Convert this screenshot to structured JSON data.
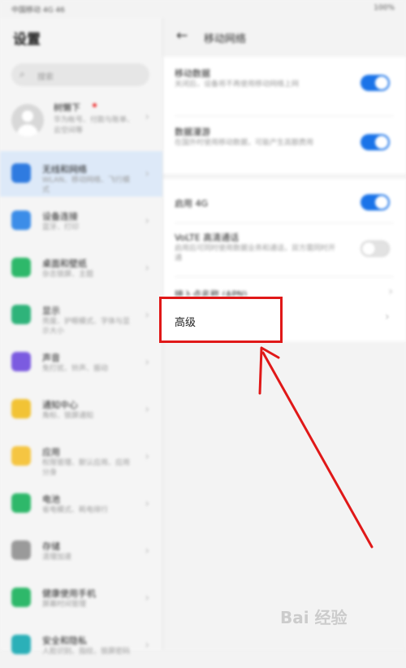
{
  "status_bar": {
    "left": "中国移动 4G 46",
    "right": "100%"
  },
  "settings": {
    "title": "设置",
    "search_placeholder": "搜索",
    "profile": {
      "name": "树懒下",
      "desc": "华为帐号、付款与账单、云空间等"
    },
    "items": [
      {
        "title": "无线和网络",
        "desc": "WLAN、移动网络、飞行模式",
        "color": "#2f7be0",
        "selected": true
      },
      {
        "title": "设备连接",
        "desc": "蓝牙、打印",
        "color": "#3c8de8"
      },
      {
        "title": "桌面和壁纸",
        "desc": "杂志锁屏、主题",
        "color": "#2eb86a"
      },
      {
        "title": "显示",
        "desc": "亮度、护眼模式、字体与显示大小",
        "color": "#2fb37a"
      },
      {
        "title": "声音",
        "desc": "免打扰、铃声、振动",
        "color": "#7b5be0"
      },
      {
        "title": "通知中心",
        "desc": "角标、锁屏通知",
        "color": "#f2c335"
      },
      {
        "title": "应用",
        "desc": "权限管理、默认应用、应用分身",
        "color": "#f5c542"
      },
      {
        "title": "电池",
        "desc": "省电模式、耗电排行",
        "color": "#2eb86a"
      },
      {
        "title": "存储",
        "desc": "清理加速",
        "color": "#9a9a9a"
      },
      {
        "title": "健康使用手机",
        "desc": "屏幕时间管理",
        "color": "#2eb86a"
      },
      {
        "title": "安全和隐私",
        "desc": "人脸识别、指纹、锁屏密码",
        "color": "#2bb0b8"
      }
    ]
  },
  "mobile_network": {
    "title": "移动网络",
    "rows": [
      {
        "title": "移动数据",
        "desc": "关闭后，设备将不再使用移动网络上网",
        "toggle": "on"
      },
      {
        "title": "数据漫游",
        "desc": "在国外时使用移动数据，可能产生高额费用",
        "toggle": "on"
      },
      {
        "title": "启用 4G",
        "desc": "",
        "toggle": "on"
      },
      {
        "title": "VoLTE 高清通话",
        "desc": "启用后可同时使用数据业务和通话，双方需同时开通",
        "toggle": "off"
      },
      {
        "title": "接入点名称 (APN)",
        "desc": "",
        "toggle": "none"
      }
    ],
    "advanced_label": "高级"
  },
  "watermark": "Bai 经验"
}
